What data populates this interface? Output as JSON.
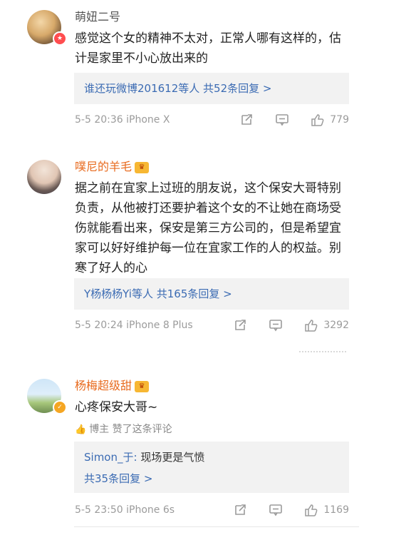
{
  "comments": [
    {
      "username": "萌妞二号",
      "text": "感觉这个女的精神不太对，正常人哪有这样的，估计是家里不小心放出来的",
      "reply_summary": "谁还玩微博201612等人 共52条回复 >",
      "meta": "5-5 20:36 iPhone X",
      "likes": "779",
      "icons": [
        "forward-icon",
        "comment-icon",
        "like-icon"
      ]
    },
    {
      "username": "噗尼的羊毛",
      "text": "据之前在宜家上过班的朋友说，这个保安大哥特别负责，从他被打还要护着这个女的不让她在商场受伤就能看出来，保安是第三方公司的，但是希望宜家可以好好维护每一位在宜家工作的人的权益。别寒了好人的心",
      "reply_summary": "Y杨杨杨Yi等人 共165条回复 >",
      "meta": "5-5 20:24 iPhone 8 Plus",
      "likes": "3292",
      "icons": [
        "forward-icon",
        "comment-icon",
        "like-icon"
      ]
    },
    {
      "username": "杨梅超级甜",
      "text": "心疼保安大哥~",
      "author_like": "博主 赞了这条评论",
      "reply_preview_name": "Simon_于:",
      "reply_preview_text": " 现场更是气愤",
      "reply_total": "共35条回复 >",
      "meta": "5-5 23:50 iPhone 6s",
      "likes": "1169",
      "icons": [
        "forward-icon",
        "comment-icon",
        "like-icon"
      ]
    }
  ],
  "colors": {
    "link_blue": "#3b6bb3",
    "username_orange": "#e86b1f",
    "meta_gray": "#9b9b9b"
  }
}
